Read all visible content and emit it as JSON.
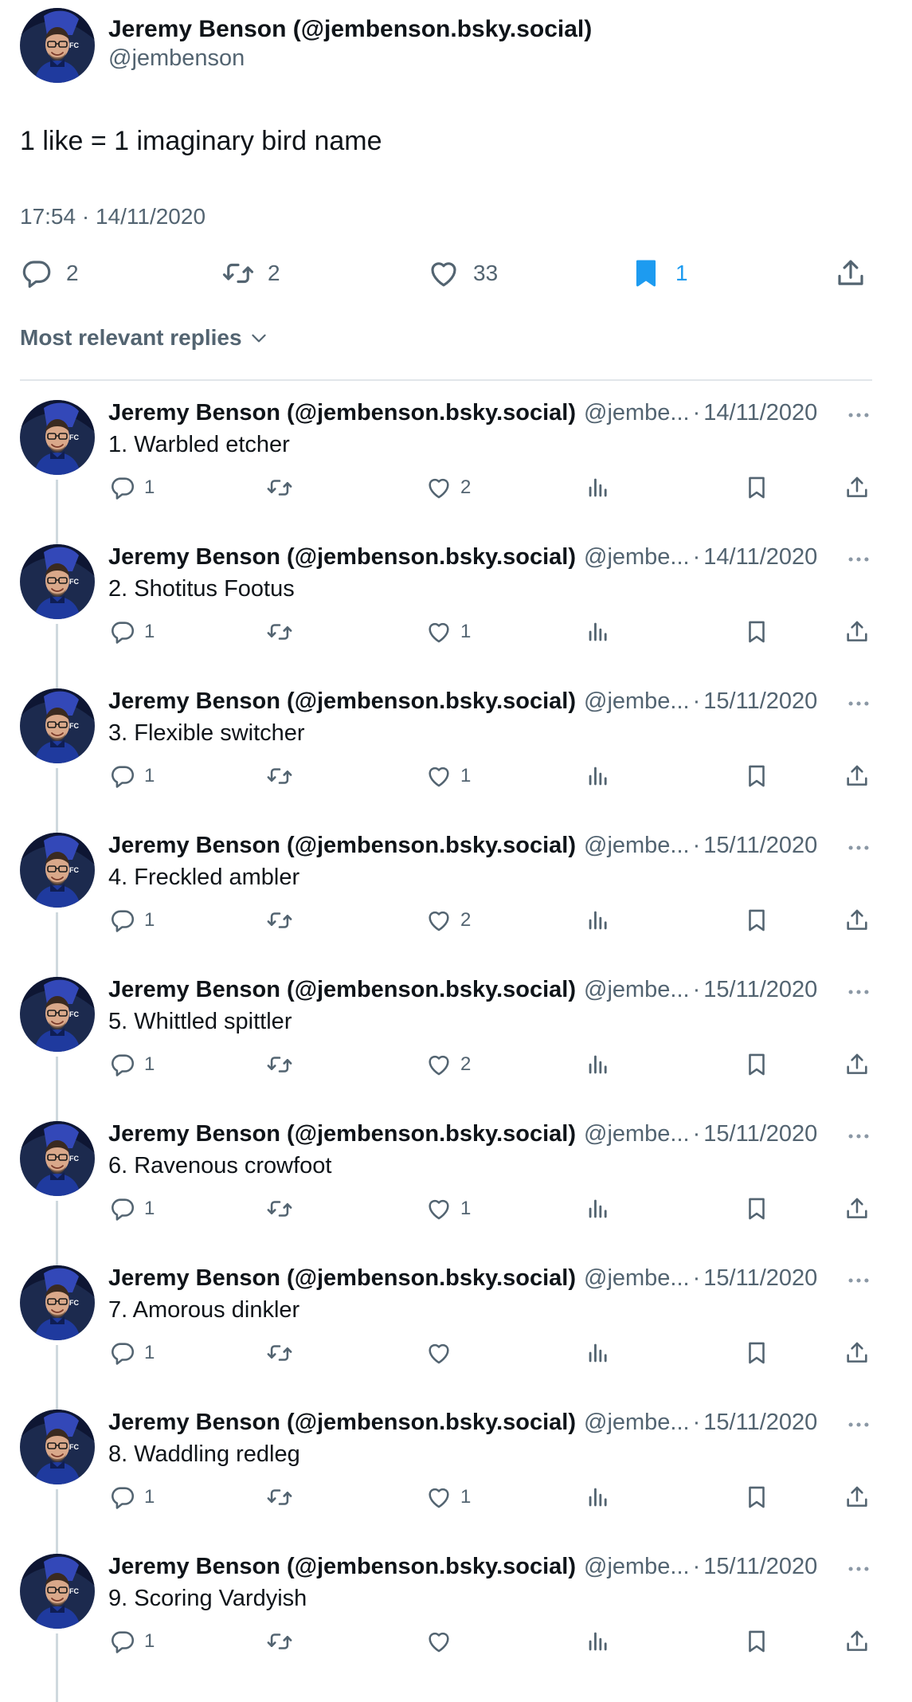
{
  "main_tweet": {
    "author_name": "Jeremy Benson (@jembenson.bsky.social)",
    "author_handle": "@jembenson",
    "text": "1 like = 1 imaginary bird name",
    "timestamp": "17:54 · 14/11/2020",
    "stats": {
      "replies": "2",
      "reposts": "2",
      "likes": "33",
      "bookmarks": "1"
    }
  },
  "sort_label": "Most relevant replies",
  "replies": [
    {
      "name": "Jeremy Benson (@jembenson.bsky.social)",
      "handle": "@jembe...",
      "date": "14/11/2020",
      "text": "1. Warbled etcher",
      "reply_count": "1",
      "like_count": "2"
    },
    {
      "name": "Jeremy Benson (@jembenson.bsky.social)",
      "handle": "@jembe...",
      "date": "14/11/2020",
      "text": "2. Shotitus Footus",
      "reply_count": "1",
      "like_count": "1"
    },
    {
      "name": "Jeremy Benson (@jembenson.bsky.social)",
      "handle": "@jembe...",
      "date": "15/11/2020",
      "text": "3. Flexible switcher",
      "reply_count": "1",
      "like_count": "1"
    },
    {
      "name": "Jeremy Benson (@jembenson.bsky.social)",
      "handle": "@jembe...",
      "date": "15/11/2020",
      "text": "4. Freckled ambler",
      "reply_count": "1",
      "like_count": "2"
    },
    {
      "name": "Jeremy Benson (@jembenson.bsky.social)",
      "handle": "@jembe...",
      "date": "15/11/2020",
      "text": "5. Whittled spittler",
      "reply_count": "1",
      "like_count": "2"
    },
    {
      "name": "Jeremy Benson (@jembenson.bsky.social)",
      "handle": "@jembe...",
      "date": "15/11/2020",
      "text": "6. Ravenous crowfoot",
      "reply_count": "1",
      "like_count": "1"
    },
    {
      "name": "Jeremy Benson (@jembenson.bsky.social)",
      "handle": "@jembe...",
      "date": "15/11/2020",
      "text": "7. Amorous dinkler",
      "reply_count": "1",
      "like_count": ""
    },
    {
      "name": "Jeremy Benson (@jembenson.bsky.social)",
      "handle": "@jembe...",
      "date": "15/11/2020",
      "text": "8. Waddling redleg",
      "reply_count": "1",
      "like_count": "1"
    },
    {
      "name": "Jeremy Benson (@jembenson.bsky.social)",
      "handle": "@jembe...",
      "date": "15/11/2020",
      "text": "9. Scoring Vardyish",
      "reply_count": "1",
      "like_count": ""
    }
  ],
  "icons": {
    "reply": "reply-icon",
    "repost": "repost-icon",
    "like": "heart-icon",
    "views": "views-icon",
    "bookmark": "bookmark-icon",
    "share": "share-icon",
    "more": "more-icon",
    "sort": "chevron-down-icon"
  },
  "colors": {
    "text": "#0f1419",
    "secondary": "#536471",
    "accent": "#1d9bf0",
    "divider": "#e1e6ea",
    "thread_line": "#cfd9de"
  }
}
